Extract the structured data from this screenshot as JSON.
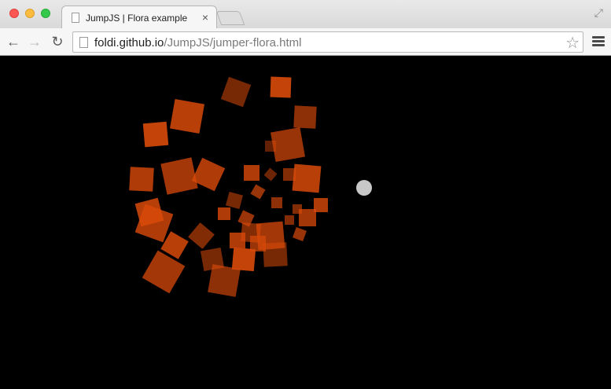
{
  "window": {
    "tab_title": "JumpJS | Flora example",
    "tab_close": "×",
    "fullscreen": "⤢"
  },
  "toolbar": {
    "back": "←",
    "forward": "→",
    "reload": "↻",
    "url_host": "foldi.github.io",
    "url_path": "/JumpJS/jumper-flora.html",
    "bookmark_star": "☆"
  },
  "scene": {
    "background_color": "#000000",
    "shape_color": "#d94a0a",
    "orb_color": "#c8c8c8"
  }
}
